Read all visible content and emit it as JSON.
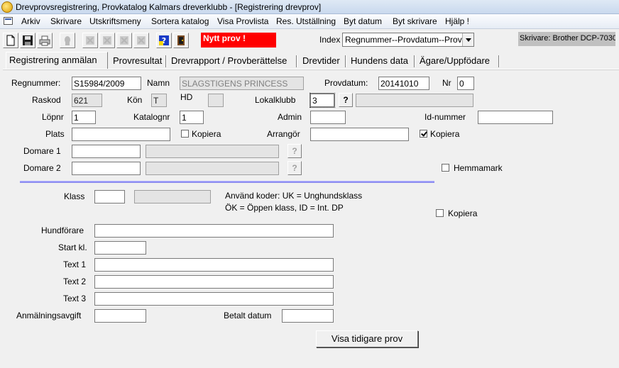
{
  "window": {
    "title": "Drevprovsregistrering, Provkatalog  Kalmars dreverklubb - [Registrering drevprov]"
  },
  "menu": [
    "Arkiv",
    "Skrivare",
    "Utskriftsmeny",
    "Sortera katalog",
    "Visa Provlista",
    "Res. Utställning",
    "Byt datum",
    "Byt skrivare",
    "Hjälp !"
  ],
  "toolbar": {
    "buttons": [
      {
        "icon": "new-document-icon",
        "enabled": true
      },
      {
        "icon": "save-icon",
        "enabled": true
      },
      {
        "icon": "print-icon",
        "enabled": true
      },
      {
        "icon": "dog-icon",
        "enabled": false
      },
      {
        "icon": "first-record-icon",
        "enabled": false
      },
      {
        "icon": "previous-record-icon",
        "enabled": false
      },
      {
        "icon": "next-record-icon",
        "enabled": false
      },
      {
        "icon": "last-record-icon",
        "enabled": false
      },
      {
        "icon": "help-icon",
        "enabled": true
      },
      {
        "icon": "exit-icon",
        "enabled": true
      }
    ],
    "status_label": "Nytt prov !",
    "status_color": "#ff0000",
    "index_label": "Index",
    "index_value": "Regnummer--Provdatum--Provnr",
    "printer": "Skrivare: Brother DCP-7030"
  },
  "tabs": [
    {
      "label": "Registrering anmälan",
      "active": true
    },
    {
      "label": "Provresultat",
      "active": false
    },
    {
      "label": "Drevrapport / Provberättelse",
      "active": false
    },
    {
      "label": "Drevtider",
      "active": false
    },
    {
      "label": "Hundens data",
      "active": false
    },
    {
      "label": "Ägare/Uppfödare",
      "active": false
    }
  ],
  "form": {
    "regnummer": {
      "label": "Regnummer:",
      "value": "S15984/2009"
    },
    "namn": {
      "label": "Namn",
      "value": "SLAGSTIGENS PRINCESS"
    },
    "provdatum": {
      "label": "Provdatum:",
      "value": "20141010"
    },
    "nr": {
      "label": "Nr",
      "value": "0"
    },
    "raskod": {
      "label": "Raskod",
      "value": "621"
    },
    "kon": {
      "label": "Kön",
      "value": "T"
    },
    "hd": {
      "label": "HD",
      "value": ""
    },
    "lokalklubb": {
      "label": "Lokalklubb",
      "value": "3",
      "name_value": ""
    },
    "lopnr": {
      "label": "Löpnr",
      "value": "1"
    },
    "katalognr": {
      "label": "Katalognr",
      "value": "1"
    },
    "admin": {
      "label": "Admin",
      "value": ""
    },
    "id_nummer": {
      "label": "Id-nummer",
      "value": ""
    },
    "plats": {
      "label": "Plats",
      "value": ""
    },
    "kopiera_plats": {
      "label": "Kopiera",
      "checked": false
    },
    "arrangor": {
      "label": "Arrangör",
      "value": ""
    },
    "kopiera_arrangor": {
      "label": "Kopiera",
      "checked": true
    },
    "domare1": {
      "label": "Domare 1",
      "value": "",
      "name_value": ""
    },
    "domare2": {
      "label": "Domare 2",
      "value": "",
      "name_value": ""
    },
    "hemmamark": {
      "label": "Hemmamark",
      "checked": false
    },
    "klass": {
      "label": "Klass",
      "value": "",
      "name_value": ""
    },
    "klass_hint_1": "Använd koder: UK = Unghundsklass",
    "klass_hint_2": "ÖK = Öppen klass, ID = Int. DP",
    "kopiera_klass": {
      "label": "Kopiera",
      "checked": false
    },
    "hundforare": {
      "label": "Hundförare",
      "value": ""
    },
    "start_kl": {
      "label": "Start kl.",
      "value": ""
    },
    "text1": {
      "label": "Text 1",
      "value": ""
    },
    "text2": {
      "label": "Text 2",
      "value": ""
    },
    "text3": {
      "label": "Text 3",
      "value": ""
    },
    "anmalningsavgift": {
      "label": "Anmälningsavgift",
      "value": ""
    },
    "betalt_datum": {
      "label": "Betalt datum",
      "value": ""
    },
    "question_mark": "?",
    "visa_tidigare_prov": "Visa tidigare prov"
  }
}
